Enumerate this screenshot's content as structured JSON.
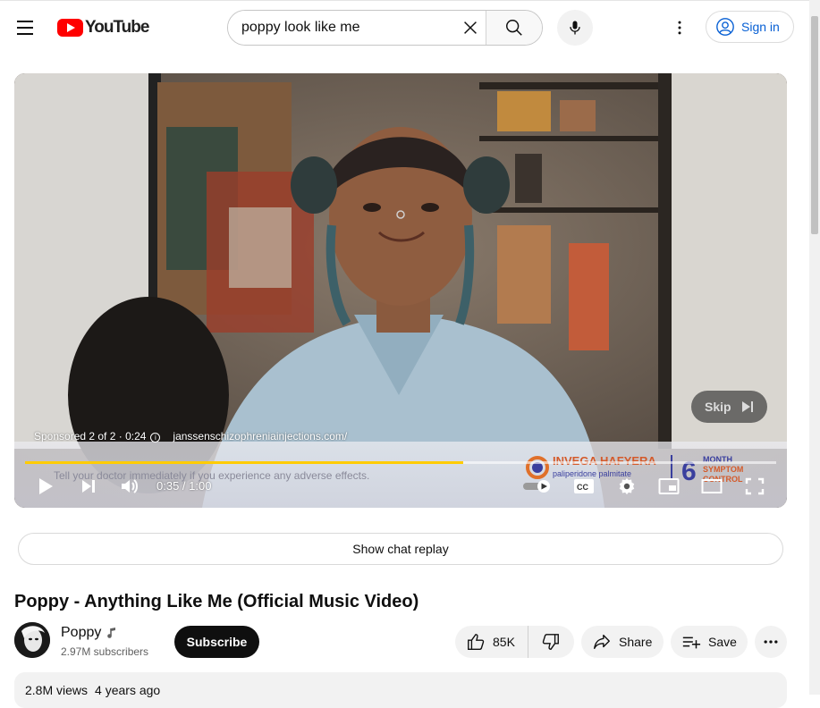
{
  "header": {
    "logo_text": "YouTube",
    "search": {
      "value": "poppy look like me"
    },
    "signin_label": "Sign in"
  },
  "player": {
    "ad_status": "Sponsored 2 of 2 · 0:24",
    "ad_url": "janssenschizophreniainjections.com/",
    "skip_label": "Skip",
    "disclaimer": "Tell your doctor immediately if you experience any adverse effects.",
    "brand_name": "INVEGA HAFYERA",
    "brand_generic": "paliperidone palmitate",
    "brand_big_number": "6",
    "brand_tagline_1": "MONTH",
    "brand_tagline_2": "SYMPTOM",
    "brand_tagline_3": "CONTROL",
    "time": "0:35 / 1:00",
    "progress_fraction": 0.583,
    "accent_color": "#ffcc00"
  },
  "chat_replay_label": "Show chat replay",
  "video": {
    "title": "Poppy - Anything Like Me (Official Music Video)",
    "channel": "Poppy",
    "subscribers": "2.97M subscribers",
    "subscribe_label": "Subscribe",
    "likes": "85K",
    "share_label": "Share",
    "save_label": "Save",
    "views": "2.8M views",
    "age": "4 years ago"
  },
  "icons": [
    "menu-icon",
    "search-icon",
    "clear-icon",
    "mic-icon",
    "more-vert-icon",
    "user-circle-icon",
    "play-icon",
    "next-icon",
    "volume-icon",
    "autoplay-icon",
    "cc-icon",
    "settings-icon",
    "miniplayer-icon",
    "theater-icon",
    "fullscreen-icon",
    "music-note-icon",
    "thumb-up-icon",
    "thumb-down-icon",
    "share-icon",
    "playlist-add-icon",
    "more-horiz-icon"
  ]
}
